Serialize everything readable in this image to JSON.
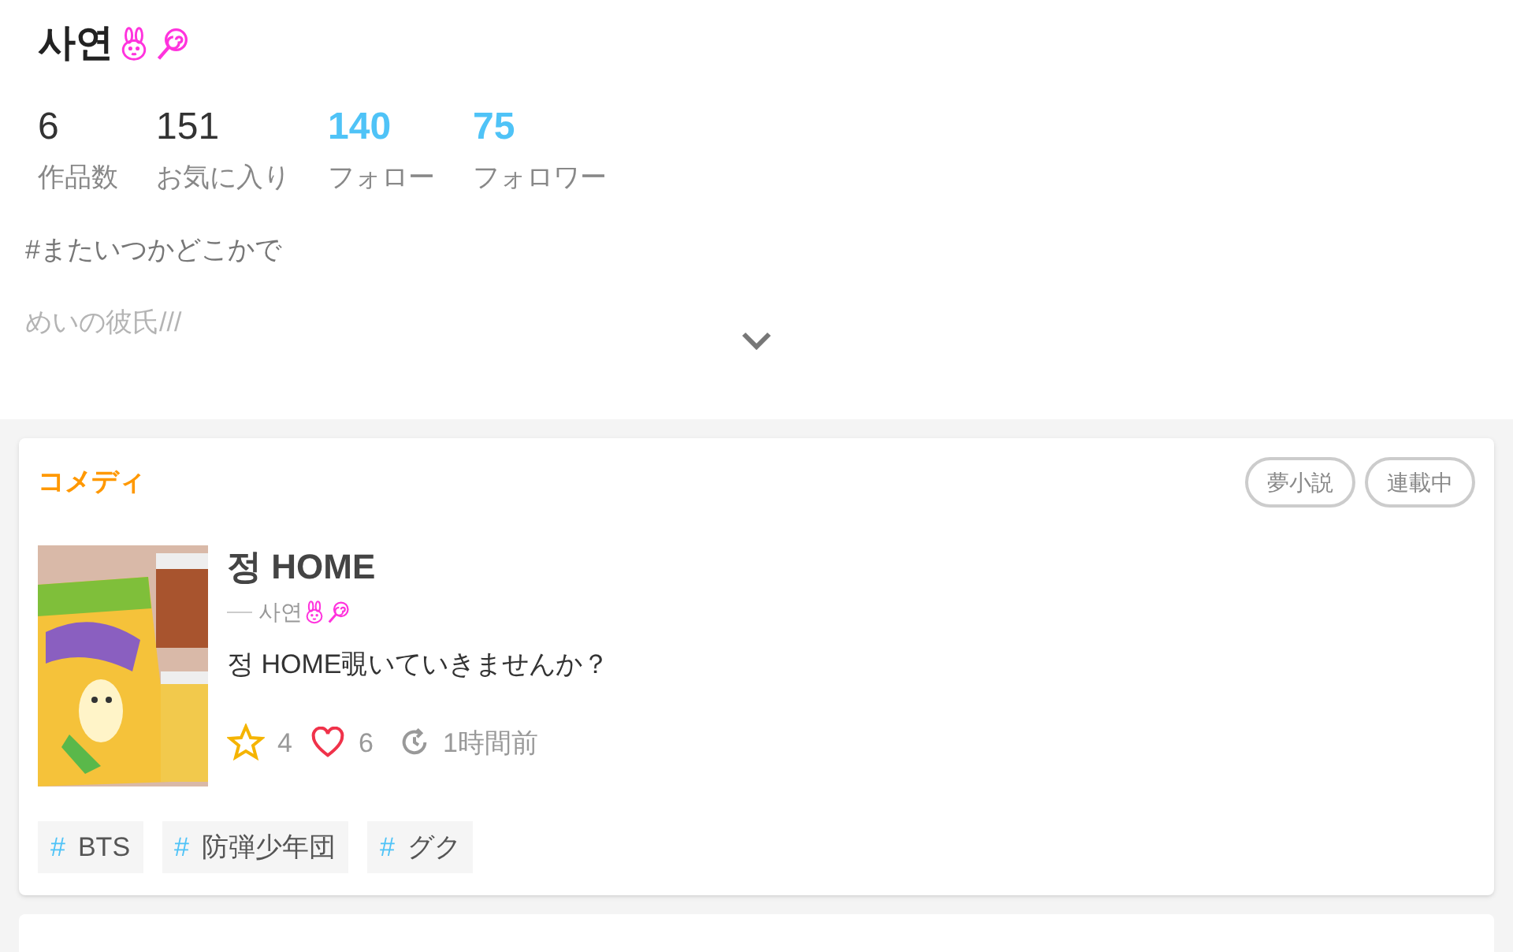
{
  "profile": {
    "name": "사연",
    "stats": [
      {
        "value": "6",
        "label": "作品数",
        "highlighted": false
      },
      {
        "value": "151",
        "label": "お気に入り",
        "highlighted": false
      },
      {
        "value": "140",
        "label": "フォロー",
        "highlighted": true
      },
      {
        "value": "75",
        "label": "フォロワー",
        "highlighted": true
      }
    ],
    "bio": [
      "#またいつかどこかで",
      "めいの彼氏///"
    ],
    "expanded": false
  },
  "works": [
    {
      "genre": "コメディ",
      "badges": [
        "夢小説",
        "連載中"
      ],
      "title": "정 HOME",
      "author": "사연",
      "description": "정 HOME覗いていきませんか？",
      "stars": "4",
      "likes": "6",
      "updated": "1時間前",
      "tags": [
        {
          "symbol": "#",
          "label": "BTS"
        },
        {
          "symbol": "#",
          "label": "防弾少年団"
        },
        {
          "symbol": "#",
          "label": "グク"
        }
      ]
    }
  ],
  "more_cards": true
}
